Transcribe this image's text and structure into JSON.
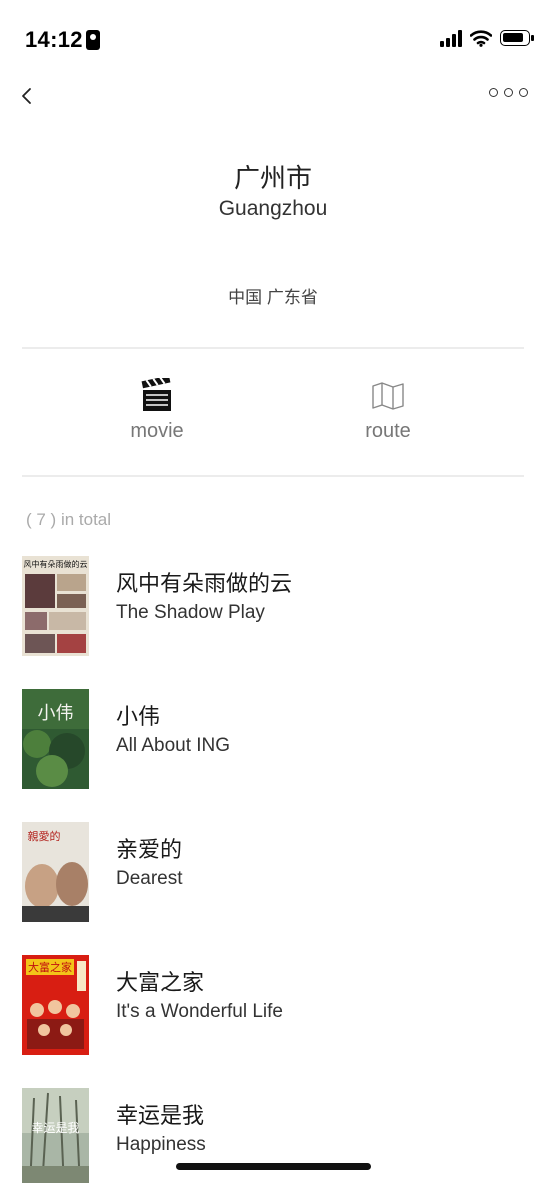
{
  "status_bar": {
    "time": "14:12"
  },
  "header": {
    "city_zh": "广州市",
    "city_en": "Guangzhou",
    "region": "中国 广东省"
  },
  "tabs": [
    {
      "label": "movie",
      "icon": "clapperboard-icon"
    },
    {
      "label": "route",
      "icon": "map-icon"
    }
  ],
  "total_text": "( 7 ) in total",
  "movies": [
    {
      "title_zh": "风中有朵雨做的云",
      "title_en": "The Shadow Play",
      "poster_text": "风中有朵雨做的云"
    },
    {
      "title_zh": "小伟",
      "title_en": "All About ING",
      "poster_text": "小伟"
    },
    {
      "title_zh": "亲爱的",
      "title_en": "Dearest",
      "poster_text": "親愛的"
    },
    {
      "title_zh": "大富之家",
      "title_en": "It's a Wonderful Life",
      "poster_text": "大富之家"
    },
    {
      "title_zh": "幸运是我",
      "title_en": "Happiness",
      "poster_text": "幸运是我"
    }
  ]
}
